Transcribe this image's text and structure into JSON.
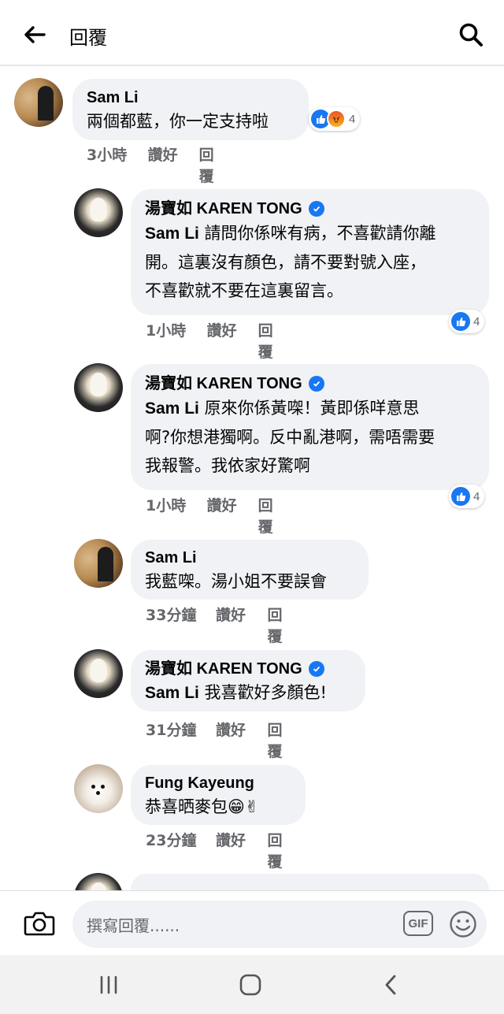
{
  "header": {
    "title": "回覆"
  },
  "comments": [
    {
      "author": "Sam Li",
      "mention": "",
      "text": "兩個都藍，你一定支持啦",
      "time": "3小時",
      "like": "讚好",
      "reply": "回覆",
      "reaction_count": "4",
      "reaction_icons": [
        "like-icon",
        "angry-icon"
      ]
    },
    {
      "author": "湯寶如 KAREN TONG",
      "mention": "Sam Li",
      "text": " 請問你係咪有病，不喜歡請你離\n開。這裏沒有顏色，請不要對號入座，\n不喜歡就不要在這裏留言。",
      "time": "1小時",
      "like": "讚好",
      "reply": "回覆",
      "reaction_count": "4",
      "reaction_icons": [
        "like-icon"
      ]
    },
    {
      "author": "湯寶如 KAREN TONG",
      "mention": "Sam Li",
      "text": " 原來你係黃㗎！黃即係咩意思\n啊?你想港獨啊。反中亂港啊，需唔需要\n我報警。我依家好驚啊",
      "time": "1小時",
      "like": "讚好",
      "reply": "回覆",
      "reaction_count": "4",
      "reaction_icons": [
        "like-icon"
      ]
    },
    {
      "author": "Sam Li",
      "mention": "",
      "text": "我藍㗎。湯小姐不要誤會",
      "time": "33分鐘",
      "like": "讚好",
      "reply": "回覆"
    },
    {
      "author": "湯寶如 KAREN TONG",
      "mention": "Sam Li",
      "text": " 我喜歡好多顏色!",
      "time": "31分鐘",
      "like": "讚好",
      "reply": "回覆"
    },
    {
      "author": "Fung Kayeung",
      "mention": "",
      "text": "恭喜晒麥包😁✌",
      "time": "23分鐘",
      "like": "讚好",
      "reply": "回覆"
    }
  ],
  "compose": {
    "placeholder": "撰寫回覆......",
    "gif_label": "GIF"
  },
  "colors": {
    "accent": "#1877f2",
    "bubble": "#f0f2f5",
    "meta_text": "#65676b"
  }
}
